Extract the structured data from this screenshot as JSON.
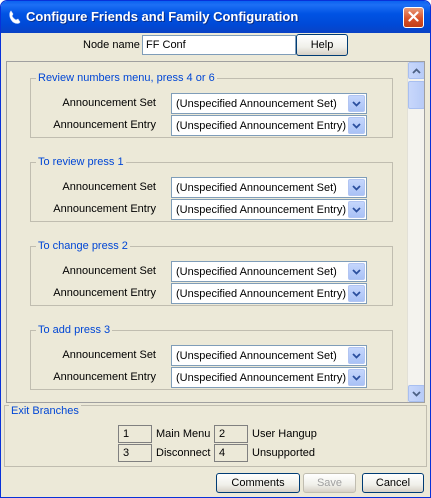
{
  "window": {
    "title": "Configure Friends and Family Configuration"
  },
  "node": {
    "label": "Node name",
    "value": "FF Conf",
    "help_label": "Help"
  },
  "groups": [
    {
      "title": "Review numbers menu, press 4 or 6",
      "set_label": "Announcement Set",
      "set_value": "(Unspecified Announcement Set)",
      "entry_label": "Announcement Entry",
      "entry_value": "(Unspecified Announcement Entry)"
    },
    {
      "title": "To review press 1",
      "set_label": "Announcement Set",
      "set_value": "(Unspecified Announcement Set)",
      "entry_label": "Announcement Entry",
      "entry_value": "(Unspecified Announcement Entry)"
    },
    {
      "title": "To change press 2",
      "set_label": "Announcement Set",
      "set_value": "(Unspecified Announcement Set)",
      "entry_label": "Announcement Entry",
      "entry_value": "(Unspecified Announcement Entry)"
    },
    {
      "title": "To add press 3",
      "set_label": "Announcement Set",
      "set_value": "(Unspecified Announcement Set)",
      "entry_label": "Announcement Entry",
      "entry_value": "(Unspecified Announcement Entry)"
    }
  ],
  "exit": {
    "title": "Exit Branches",
    "branches": [
      {
        "num": "1",
        "label": "Main Menu"
      },
      {
        "num": "2",
        "label": "User Hangup"
      },
      {
        "num": "3",
        "label": "Disconnect"
      },
      {
        "num": "4",
        "label": "Unsupported"
      }
    ]
  },
  "buttons": {
    "comments": "Comments",
    "save": "Save",
    "cancel": "Cancel"
  },
  "colors": {
    "title_bar": "#0053e4",
    "group_title": "#0046d5",
    "close": "#d9522a"
  }
}
